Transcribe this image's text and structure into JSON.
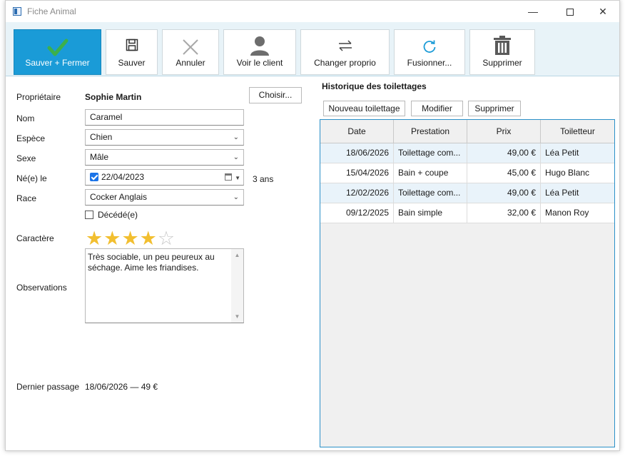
{
  "window": {
    "title": "Fiche Animal"
  },
  "toolbar": {
    "save_close": "Sauver + Fermer",
    "save": "Sauver",
    "cancel": "Annuler",
    "view_client": "Voir le client",
    "change_owner": "Changer proprio",
    "merge": "Fusionner...",
    "delete": "Supprimer"
  },
  "form": {
    "owner_label": "Propriétaire",
    "owner_value": "Sophie Martin",
    "choose_button": "Choisir...",
    "name_label": "Nom",
    "name_value": "Caramel",
    "species_label": "Espèce",
    "species_value": "Chien",
    "sex_label": "Sexe",
    "sex_value": "Mâle",
    "birth_label": "Né(e) le",
    "birth_value": "22/04/2023",
    "age": "3 ans",
    "breed_label": "Race",
    "breed_value": "Cocker Anglais",
    "deceased_label": "Décédé(e)",
    "character_label": "Caractère",
    "rating": 4,
    "rating_max": 5,
    "star_on_color": "#f2bf30",
    "observations_label": "Observations",
    "observations_value": "Très sociable, un peu peureux au séchage. Aime les friandises.",
    "last_visit_label": "Dernier passage",
    "last_visit_value": "18/06/2026 — 49 €"
  },
  "history": {
    "title": "Historique des toilettages",
    "new_button": "Nouveau toilettage",
    "edit_button": "Modifier",
    "delete_button": "Supprimer",
    "columns": [
      "Date",
      "Prestation",
      "Prix",
      "Toiletteur"
    ],
    "rows": [
      {
        "date": "18/06/2026",
        "service": "Toilettage  com...",
        "price": "49,00 €",
        "groomer": "Léa Petit"
      },
      {
        "date": "15/04/2026",
        "service": "Bain + coupe",
        "price": "45,00 €",
        "groomer": "Hugo Blanc"
      },
      {
        "date": "12/02/2026",
        "service": "Toilettage  com...",
        "price": "49,00 €",
        "groomer": "Léa Petit"
      },
      {
        "date": "09/12/2025",
        "service": "Bain simple",
        "price": "32,00 €",
        "groomer": "Manon Roy"
      }
    ]
  },
  "accent_color": "#1a9bd7"
}
